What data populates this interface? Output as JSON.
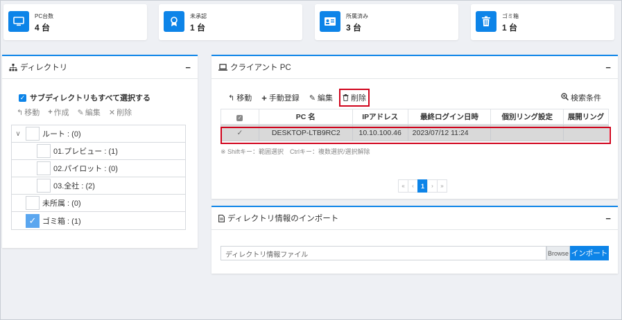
{
  "stats": [
    {
      "label": "PC台数",
      "value": "4 台",
      "icon": "desktop-icon"
    },
    {
      "label": "未承認",
      "value": "1 台",
      "icon": "badge-icon"
    },
    {
      "label": "所属済み",
      "value": "3 台",
      "icon": "id-card-icon"
    },
    {
      "label": "ゴミ箱",
      "value": "1 台",
      "icon": "trash-icon"
    }
  ],
  "directory": {
    "title": "ディレクトリ",
    "minimize": "−",
    "select_all_sub": "サブディレクトリもすべて選択する",
    "actions": {
      "move": "移動",
      "create": "作成",
      "edit": "編集",
      "delete": "削除"
    },
    "tree": [
      {
        "label": "ルート : (0)",
        "checked": false
      },
      {
        "label": "01.プレビュー : (1)",
        "checked": false
      },
      {
        "label": "02.パイロット : (0)",
        "checked": false
      },
      {
        "label": "03.全社 : (2)",
        "checked": false
      },
      {
        "label": "未所属 : (0)",
        "checked": false
      },
      {
        "label": "ゴミ箱 : (1)",
        "checked": true
      }
    ]
  },
  "clients": {
    "title": "クライアント PC",
    "minimize": "−",
    "toolbar": {
      "move": "移動",
      "manual_register": "手動登録",
      "edit": "編集",
      "delete": "削除"
    },
    "search_condition": "検索条件",
    "columns": [
      "PC 名",
      "IPアドレス",
      "最終ログイン日時",
      "個別リング設定",
      "展開リング"
    ],
    "rows": [
      {
        "checked": true,
        "pc_name": "DESKTOP-LTB9RC2",
        "ip": "10.10.100.46",
        "last_login": "2023/07/12 11:24",
        "ring_setting": "",
        "deploy_ring": ""
      }
    ],
    "hint": "※ Shiftキー：範囲選択　Ctrlキー：複数選択/選択解除",
    "pager": {
      "first": "«",
      "prev": "‹",
      "current": "1",
      "next": "›",
      "last": "»"
    }
  },
  "import": {
    "title": "ディレクトリ情報のインポート",
    "minimize": "−",
    "placeholder": "ディレクトリ情報ファイル",
    "browse": "Browse",
    "button": "インポート"
  },
  "colors": {
    "accent": "#0d84e8",
    "highlight": "#d0021b",
    "selected_row": "#d9d9d9"
  }
}
